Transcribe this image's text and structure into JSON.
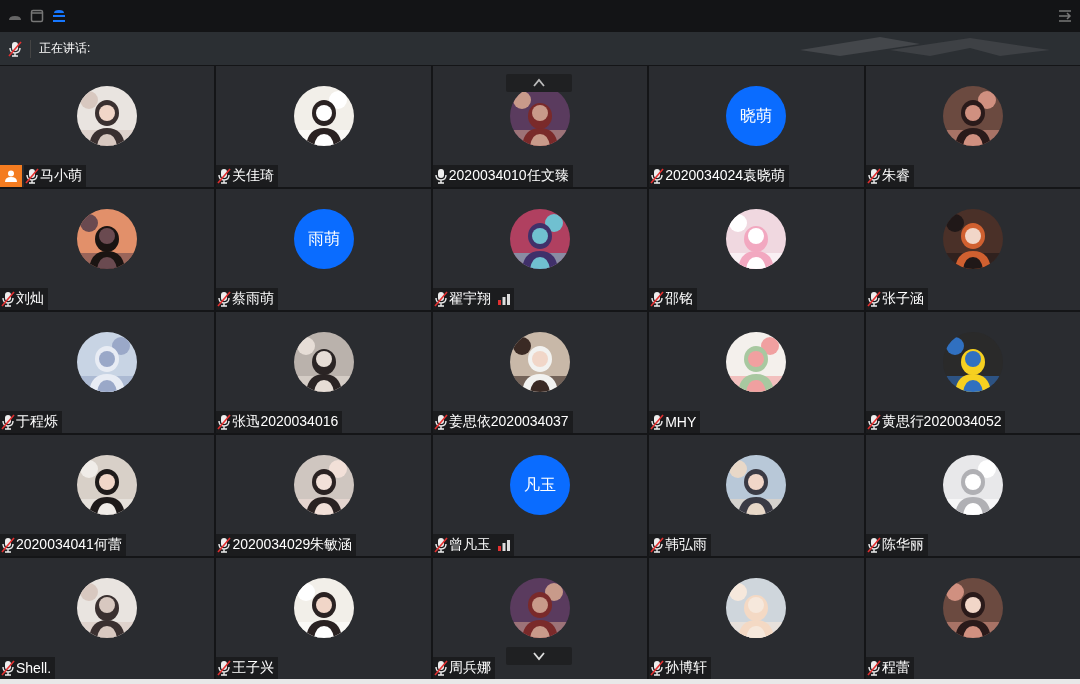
{
  "speaking_bar": {
    "label": "正在讲话:"
  },
  "participants": [
    {
      "name": "马小萌",
      "muted": true,
      "host": true,
      "signal": false
    },
    {
      "name": "关佳琦",
      "muted": true,
      "host": false,
      "signal": false
    },
    {
      "name": "2020034010任文臻",
      "muted": false,
      "host": false,
      "signal": false
    },
    {
      "name": "2020034024袁晓萌",
      "muted": true,
      "host": false,
      "signal": false,
      "avatar": {
        "kind": "initials",
        "text": "晓萌"
      }
    },
    {
      "name": "朱睿",
      "muted": true,
      "host": false,
      "signal": false
    },
    {
      "name": "刘灿",
      "muted": true,
      "host": false,
      "signal": false
    },
    {
      "name": "蔡雨萌",
      "muted": true,
      "host": false,
      "signal": false,
      "avatar": {
        "kind": "initials",
        "text": "雨萌"
      }
    },
    {
      "name": "翟宇翔",
      "muted": true,
      "host": false,
      "signal": true
    },
    {
      "name": "邵铭",
      "muted": true,
      "host": false,
      "signal": false
    },
    {
      "name": "张子涵",
      "muted": true,
      "host": false,
      "signal": false
    },
    {
      "name": "于程烁",
      "muted": true,
      "host": false,
      "signal": false
    },
    {
      "name": "张迅2020034016",
      "muted": true,
      "host": false,
      "signal": false
    },
    {
      "name": "姜思依2020034037",
      "muted": true,
      "host": false,
      "signal": false
    },
    {
      "name": "MHY",
      "muted": true,
      "host": false,
      "signal": false
    },
    {
      "name": "黄思行2020034052",
      "muted": true,
      "host": false,
      "signal": false
    },
    {
      "name": "2020034041何蕾",
      "muted": true,
      "host": false,
      "signal": false
    },
    {
      "name": "2020034029朱敏涵",
      "muted": true,
      "host": false,
      "signal": false
    },
    {
      "name": "曾凡玉",
      "muted": true,
      "host": false,
      "signal": true,
      "avatar": {
        "kind": "initials",
        "text": "凡玉"
      }
    },
    {
      "name": "韩弘雨",
      "muted": true,
      "host": false,
      "signal": false
    },
    {
      "name": "陈华丽",
      "muted": true,
      "host": false,
      "signal": false
    },
    {
      "name": "Shell.",
      "muted": true,
      "host": false,
      "signal": false
    },
    {
      "name": "王子兴",
      "muted": true,
      "host": false,
      "signal": false
    },
    {
      "name": "周兵娜",
      "muted": true,
      "host": false,
      "signal": false
    },
    {
      "name": "孙博轩",
      "muted": true,
      "host": false,
      "signal": false
    },
    {
      "name": "程蕾",
      "muted": true,
      "host": false,
      "signal": false
    }
  ]
}
